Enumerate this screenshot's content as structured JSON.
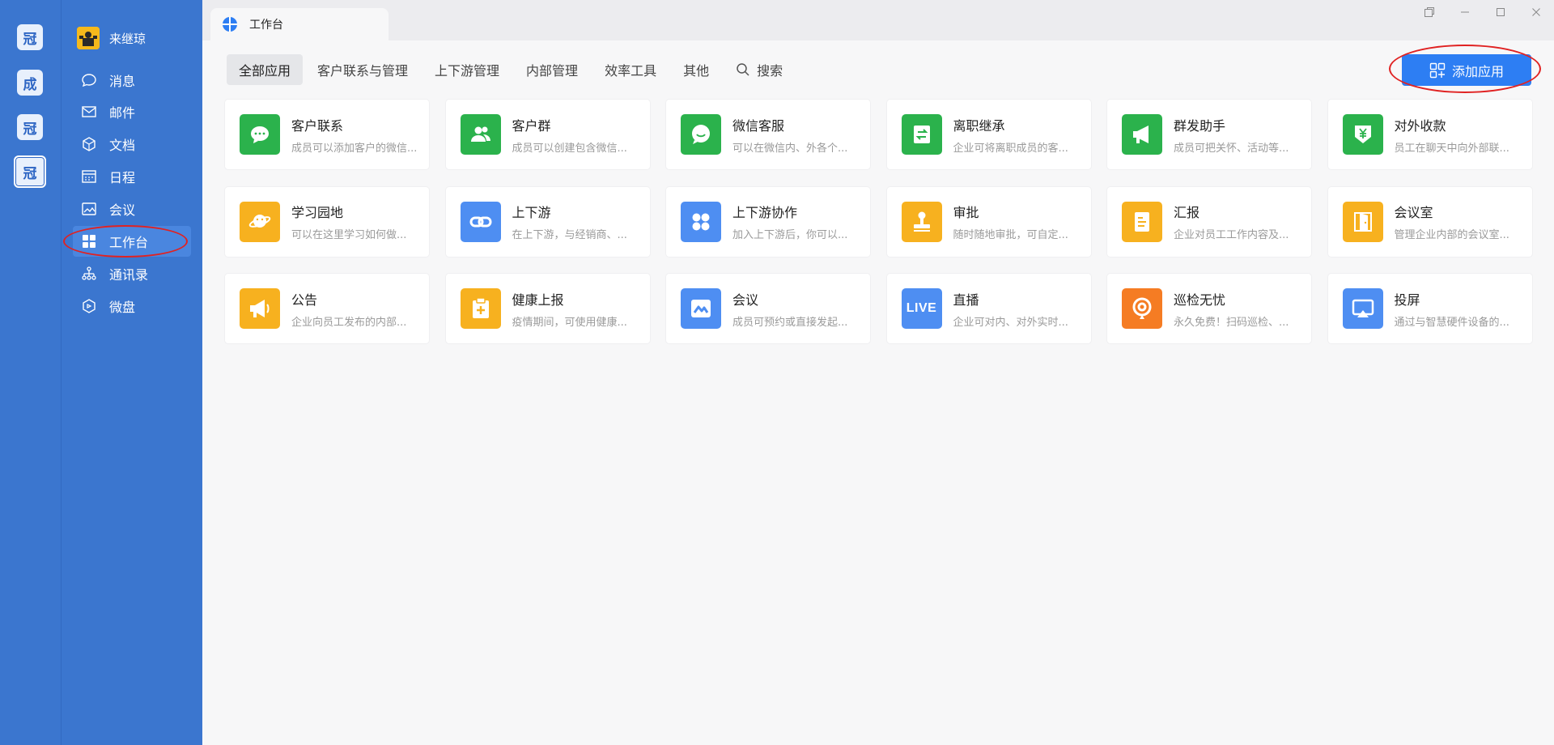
{
  "orgs": [
    {
      "label": "冠",
      "active": false
    },
    {
      "label": "成",
      "active": false
    },
    {
      "label": "冠",
      "active": false
    },
    {
      "label": "冠",
      "active": true
    }
  ],
  "profile": {
    "name": "来继琼"
  },
  "nav": [
    {
      "label": "消息",
      "icon": "chat-bubble-icon"
    },
    {
      "label": "邮件",
      "icon": "mail-icon"
    },
    {
      "label": "文档",
      "icon": "document-icon"
    },
    {
      "label": "日程",
      "icon": "calendar-icon"
    },
    {
      "label": "会议",
      "icon": "meeting-icon"
    },
    {
      "label": "工作台",
      "icon": "grid-icon",
      "active": true
    },
    {
      "label": "通讯录",
      "icon": "contacts-icon"
    },
    {
      "label": "微盘",
      "icon": "drive-icon"
    }
  ],
  "window": {
    "tab_title": "工作台"
  },
  "categories": [
    {
      "label": "全部应用",
      "active": true
    },
    {
      "label": "客户联系与管理"
    },
    {
      "label": "上下游管理"
    },
    {
      "label": "内部管理"
    },
    {
      "label": "效率工具"
    },
    {
      "label": "其他"
    }
  ],
  "search_label": "搜索",
  "add_app_label": "添加应用",
  "colors": {
    "green": "#2bb24c",
    "blue": "#4e8ef2",
    "orange": "#f7b11f",
    "red_orange": "#f57c23",
    "annotation": "#e02222"
  },
  "apps": [
    {
      "name": "客户联系",
      "desc": "成员可以添加客户的微信...",
      "color": "#2bb24c",
      "icon": "chat-icon"
    },
    {
      "name": "客户群",
      "desc": "成员可以创建包含微信...",
      "color": "#2bb24c",
      "icon": "group-icon"
    },
    {
      "name": "微信客服",
      "desc": "可以在微信内、外各个...",
      "color": "#2bb24c",
      "icon": "service-icon"
    },
    {
      "name": "离职继承",
      "desc": "企业可将离职成员的客...",
      "color": "#2bb24c",
      "icon": "transfer-icon"
    },
    {
      "name": "群发助手",
      "desc": "成员可把关怀、活动等...",
      "color": "#2bb24c",
      "icon": "megaphone-icon"
    },
    {
      "name": "对外收款",
      "desc": "员工在聊天中向外部联...",
      "color": "#2bb24c",
      "icon": "payment-icon"
    },
    {
      "name": "学习园地",
      "desc": "可以在这里学习如何做...",
      "color": "#f7b11f",
      "icon": "planet-icon"
    },
    {
      "name": "上下游",
      "desc": "在上下游，与经销商、...",
      "color": "#4e8ef2",
      "icon": "link-icon"
    },
    {
      "name": "上下游协作",
      "desc": "加入上下游后，你可以...",
      "color": "#4e8ef2",
      "icon": "clover-icon"
    },
    {
      "name": "审批",
      "desc": "随时随地审批，可自定...",
      "color": "#f7b11f",
      "icon": "stamp-icon"
    },
    {
      "name": "汇报",
      "desc": "企业对员工工作内容及...",
      "color": "#f7b11f",
      "icon": "report-icon"
    },
    {
      "name": "会议室",
      "desc": "管理企业内部的会议室...",
      "color": "#f7b11f",
      "icon": "door-icon"
    },
    {
      "name": "公告",
      "desc": "企业向员工发布的内部...",
      "color": "#f7b11f",
      "icon": "announcement-icon"
    },
    {
      "name": "健康上报",
      "desc": "疫情期间，可使用健康...",
      "color": "#f7b11f",
      "icon": "clipboard-plus-icon"
    },
    {
      "name": "会议",
      "desc": "成员可预约或直接发起...",
      "color": "#4e8ef2",
      "icon": "meeting-app-icon"
    },
    {
      "name": "直播",
      "desc": "企业可对内、对外实时...",
      "color": "#4e8ef2",
      "icon": "live-icon",
      "icon_text": "LIVE"
    },
    {
      "name": "巡检无忧",
      "desc": "永久免费！扫码巡检、...",
      "color": "#f57c23",
      "icon": "inspection-icon"
    },
    {
      "name": "投屏",
      "desc": "通过与智慧硬件设备的...",
      "color": "#4e8ef2",
      "icon": "screen-cast-icon"
    }
  ]
}
